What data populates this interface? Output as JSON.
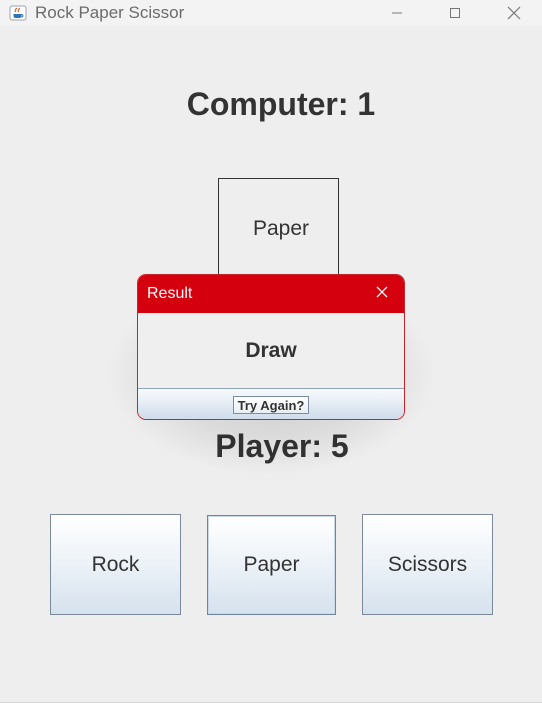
{
  "window": {
    "title": "Rock Paper Scissor",
    "icons": {
      "app": "java-icon",
      "minimize": "minimize-icon",
      "maximize": "maximize-icon",
      "close": "close-icon"
    }
  },
  "scores": {
    "computer": "Computer: 1",
    "player": "Player: 5"
  },
  "computer_choice": {
    "label": "Paper"
  },
  "dialog": {
    "title": "Result",
    "message": "Draw",
    "button": "Try Again?",
    "close_icon": "close-icon"
  },
  "choices": {
    "rock": "Rock",
    "paper": "Paper",
    "scissors": "Scissors"
  },
  "colors": {
    "dialog_header": "#d4000d",
    "background": "#eeeeee",
    "text": "#333333"
  }
}
